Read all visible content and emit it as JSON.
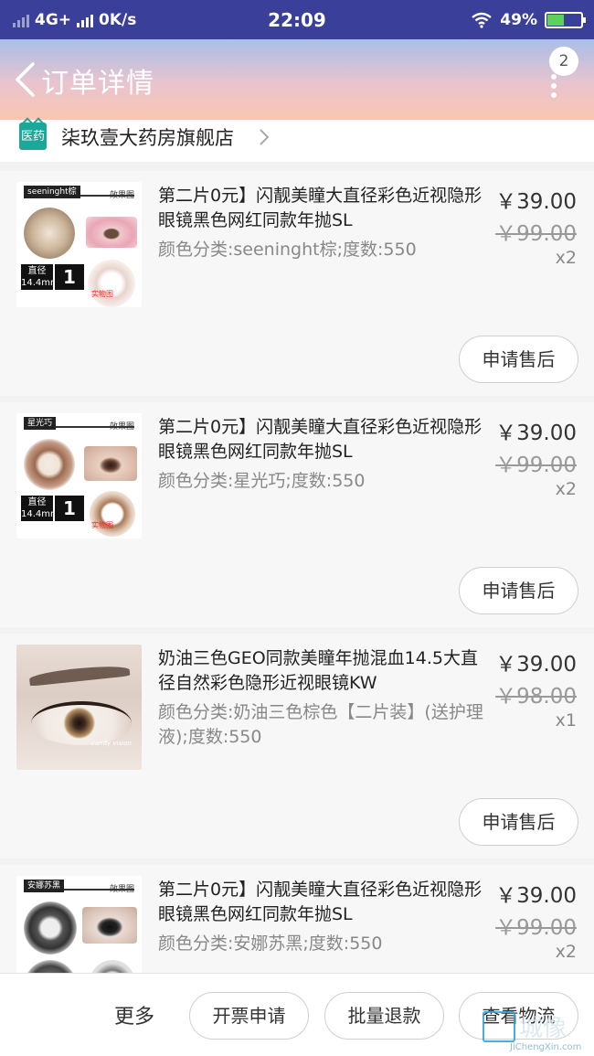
{
  "status_bar": {
    "network": "4G+",
    "speed": "0K/s",
    "time": "22:09",
    "battery": "49%",
    "battery_level": 0.49
  },
  "header": {
    "title": "订单详情",
    "badge_count": "2"
  },
  "store": {
    "icon_text": "医药",
    "name": "柒玖壹大药房旗舰店"
  },
  "items": [
    {
      "title": "第二片0元】闪靓美瞳大直径彩色近视隐形眼镜黑色网红同款年抛SL",
      "spec": "颜色分类:seeninght棕;度数:550",
      "price": "￥39.00",
      "original_price": "￥99.00",
      "quantity": "x2",
      "after_sale": "申请售后",
      "thumb_tag": "seeninght棕",
      "thumb_effect": "效果图",
      "thumb_diameter": "直径\n14.4mm",
      "thumb_pack": "1",
      "thumb_real": "实物图"
    },
    {
      "title": "第二片0元】闪靓美瞳大直径彩色近视隐形眼镜黑色网红同款年抛SL",
      "spec": "颜色分类:星光巧;度数:550",
      "price": "￥39.00",
      "original_price": "￥99.00",
      "quantity": "x2",
      "after_sale": "申请售后",
      "thumb_tag": "星光巧",
      "thumb_effect": "效果图",
      "thumb_diameter": "直径\n14.4mm",
      "thumb_pack": "1",
      "thumb_real": "实物图"
    },
    {
      "title": "奶油三色GEO同款美瞳年抛混血14.5大直径自然彩色隐形近视眼镜KW",
      "spec": "颜色分类:奶油三色棕色【二片装】(送护理液);度数:550",
      "price": "￥39.00",
      "original_price": "￥98.00",
      "quantity": "x1",
      "after_sale": "申请售后",
      "thumb_caption": "candy vision"
    },
    {
      "title": "第二片0元】闪靓美瞳大直径彩色近视隐形眼镜黑色网红同款年抛SL",
      "spec": "颜色分类:安娜苏黑;度数:550",
      "price": "￥39.00",
      "original_price": "￥99.00",
      "quantity": "x2",
      "thumb_tag": "安娜苏黑",
      "thumb_effect": "效果图"
    }
  ],
  "bottom_bar": {
    "more": "更多",
    "invoice": "开票申请",
    "batch_refund": "批量退款",
    "logistics": "查看物流"
  },
  "watermark": {
    "text": "城像",
    "url": "JiChengXin.com"
  }
}
